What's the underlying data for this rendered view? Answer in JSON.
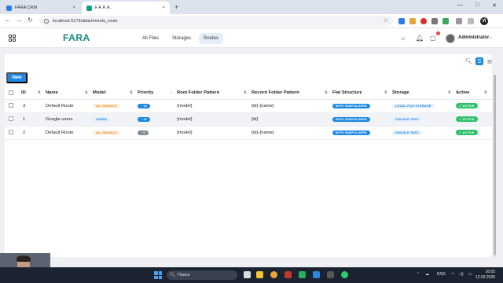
{
  "browser": {
    "tabs": [
      {
        "title": "FARA CRM",
        "close": "×"
      },
      {
        "title": "F.A.R.A.",
        "close": "×"
      }
    ],
    "new_tab": "+",
    "window_controls": [
      "—",
      "□",
      "✕"
    ],
    "url": "localhost:5173/attachments_route",
    "profile_initial": "И"
  },
  "app": {
    "logo": "FARA",
    "nav": [
      {
        "label": "All Files",
        "active": false
      },
      {
        "label": "Storages",
        "active": false
      },
      {
        "label": "Routes",
        "active": true
      }
    ],
    "notification_count": "1",
    "user_name": "Administrator"
  },
  "toolbar": {
    "new_label": "New"
  },
  "table": {
    "columns": [
      "ID",
      "Name",
      "Model",
      "Priority",
      "Root Folder Pattern",
      "Record Folder Pattern",
      "Flat Structure",
      "Storage",
      "Active"
    ],
    "rows": [
      {
        "id": "3",
        "name": "Default Route",
        "model": "ALL MODELS",
        "priority": "↑ 10",
        "root": "{model}",
        "record": "{id}-{name}",
        "flat": "WITH SUBFOLDERS",
        "storage": "LOCAL FILE STORAGE",
        "active": "✓ ACTIVE"
      },
      {
        "id": "1",
        "name": "Google users",
        "model": "USERS",
        "priority": "↑ 10",
        "root": "{model}",
        "record": "{id}",
        "flat": "WITH SUBFOLDERS",
        "storage": "GOOGLE TEST",
        "active": "✓ ACTIVE"
      },
      {
        "id": "2",
        "name": "Default Route",
        "model": "ALL MODELS",
        "priority": "↑ 0",
        "root": "{model}",
        "record": "{id}-{name}",
        "flat": "WITH SUBFOLDERS",
        "storage": "GOOGLE TEST",
        "active": "✓ ACTIVE"
      }
    ]
  },
  "taskbar": {
    "search_label": "Поиск",
    "lang": "ENG",
    "time": "16:02",
    "date": "12.02.2026"
  },
  "colors": {
    "brand": "#148a79",
    "primary": "#1e88e5",
    "active_green": "#2ec26a"
  }
}
